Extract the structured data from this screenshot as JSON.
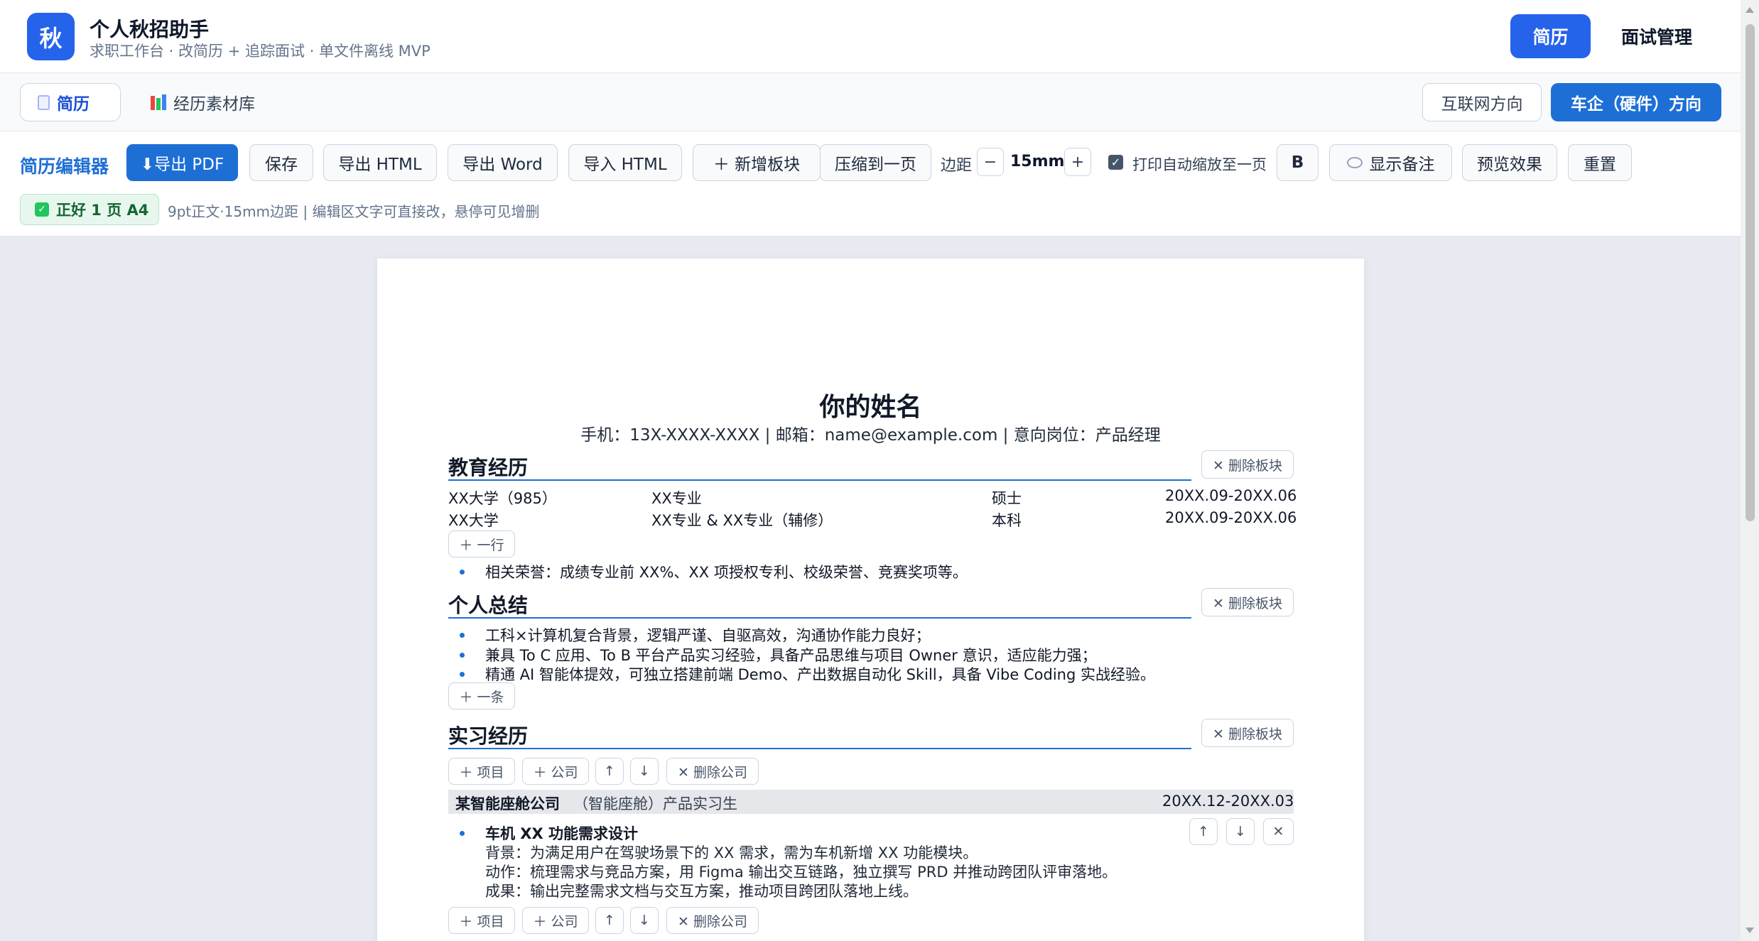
{
  "header": {
    "logo_char": "秋",
    "title": "个人秋招助手",
    "subtitle": "求职工作台 · 改简历 + 追踪面试 · 单文件离线 MVP",
    "nav_resume": "简历",
    "nav_interview": "面试管理"
  },
  "tabs": {
    "resume": "简历",
    "library": "经历素材库",
    "dir_internet": "互联网方向",
    "dir_auto": "车企（硬件）方向"
  },
  "toolbar": {
    "label": "简历编辑器",
    "export_pdf": "⬇导出 PDF",
    "save": "保存",
    "export_html": "导出 HTML",
    "export_word": "导出 Word",
    "import_html": "导入 HTML",
    "add_block": "＋ 新增板块",
    "compress": "压缩到一页",
    "margin_label": "边距",
    "minus": "−",
    "margin_value": "15mm",
    "plus": "+",
    "auto_scale": "打印自动缩放至一页",
    "bold": "B",
    "show_notes": "显示备注",
    "preview": "预览效果",
    "reset": "重置",
    "status": "正好 1 页 A4",
    "status_note": "9pt正文·15mm边距 | 编辑区文字可直接改，悬停可见增删"
  },
  "resume": {
    "name": "你的姓名",
    "contact": "手机：13X-XXXX-XXXX | 邮箱：name@example.com | 意向岗位：产品经理",
    "delete_block": "✕ 删除板块",
    "education": {
      "title": "教育经历",
      "rows": [
        {
          "school": "XX大学（985）",
          "major": "XX专业",
          "degree": "硕士",
          "date": "20XX.09-20XX.06"
        },
        {
          "school": "XX大学",
          "major": "XX专业 & XX专业（辅修）",
          "degree": "本科",
          "date": "20XX.09-20XX.06"
        }
      ],
      "add_row": "＋ 一行",
      "honor": "相关荣誉：成绩专业前 XX%、XX 项授权专利、校级荣誉、竞赛奖项等。"
    },
    "summary": {
      "title": "个人总结",
      "items": [
        "工科×计算机复合背景，逻辑严谨、自驱高效，沟通协作能力良好；",
        "兼具 To C 应用、To B 平台产品实习经验，具备产品思维与项目 Owner 意识，适应能力强；",
        "精通 AI 智能体提效，可独立搭建前端 Demo、产出数据自动化 Skill，具备 Vibe Coding 实战经验。"
      ],
      "add_item": "＋ 一条"
    },
    "internship": {
      "title": "实习经历",
      "add_project": "＋ 项目",
      "add_company": "＋ 公司",
      "move_up": "↑",
      "move_down": "↓",
      "delete_company": "✕ 删除公司",
      "delete_item": "✕",
      "company": "某智能座舱公司",
      "role": "（智能座舱）产品实习生",
      "date": "20XX.12-20XX.03",
      "item_title": "车机 XX 功能需求设计",
      "details": [
        "背景：为满足用户在驾驶场景下的 XX 需求，需为车机新增 XX 功能模块。",
        "动作：梳理需求与竞品方案，用 Figma 输出交互链路，独立撰写 PRD 并推动跨团队评审落地。",
        "成果：输出完整需求文档与交互方案，推动项目跨团队落地上线。"
      ]
    }
  }
}
